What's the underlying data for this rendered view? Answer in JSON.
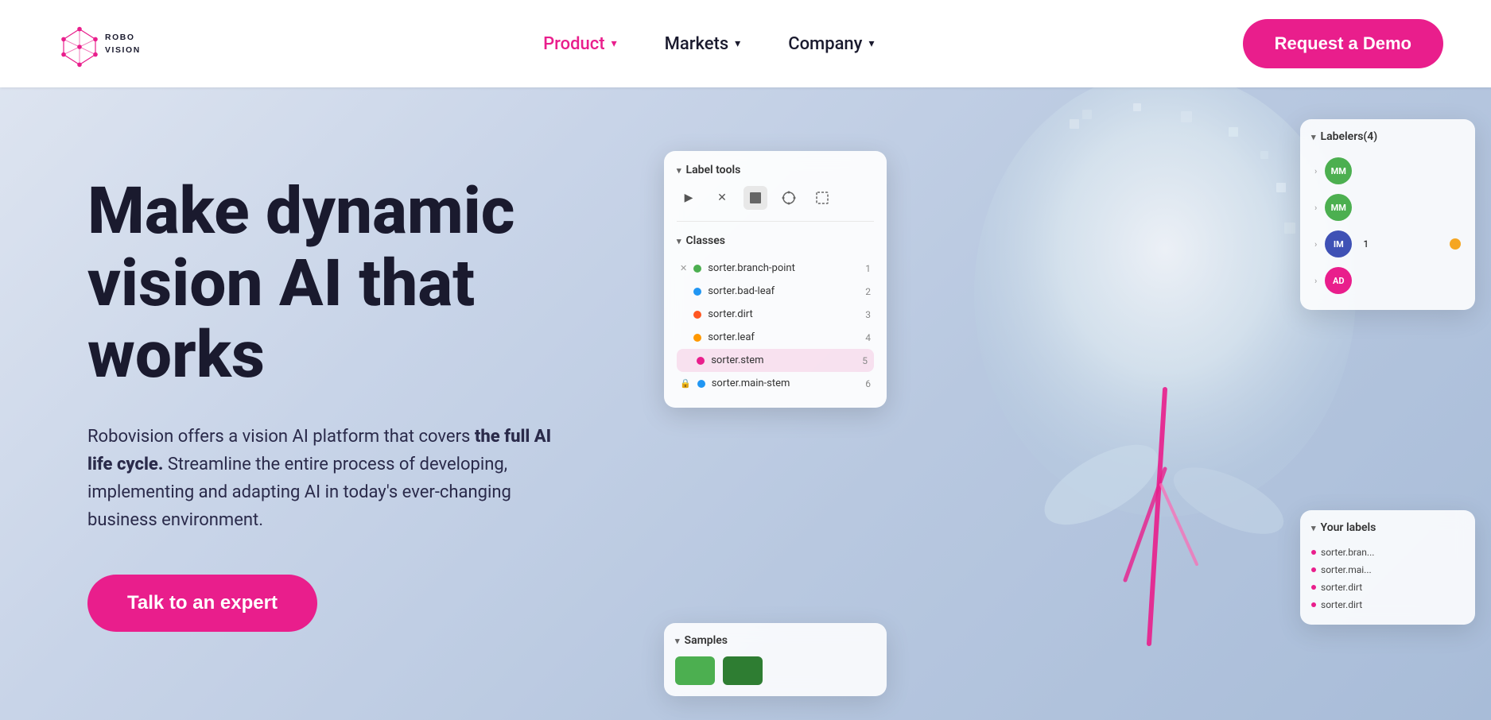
{
  "navbar": {
    "logo_text": "ROBOVISION",
    "nav_items": [
      {
        "label": "Product",
        "active": true,
        "has_dropdown": true
      },
      {
        "label": "Markets",
        "active": false,
        "has_dropdown": true
      },
      {
        "label": "Company",
        "active": false,
        "has_dropdown": true
      }
    ],
    "cta_label": "Request a Demo"
  },
  "hero": {
    "title_line1": "Make dynamic",
    "title_line2": "vision AI that",
    "title_line3": "works",
    "description_normal": "Robovision offers a vision AI platform that covers ",
    "description_bold": "the full AI life cycle.",
    "description_normal2": " Streamline the entire process of developing, implementing and adapting AI in today's ever-changing business environment.",
    "cta_label": "Talk to an expert"
  },
  "label_tools_panel": {
    "title": "Label tools",
    "tools": [
      "▶",
      "✕",
      "□",
      "○",
      "⬚"
    ],
    "classes_title": "Classes",
    "classes": [
      {
        "name": "sorter.branch-point",
        "color": "#4caf50",
        "number": "1",
        "prefix": "✕"
      },
      {
        "name": "sorter.bad-leaf",
        "color": "#2196f3",
        "number": "2",
        "prefix": ""
      },
      {
        "name": "sorter.dirt",
        "color": "#ff5722",
        "number": "3",
        "prefix": ""
      },
      {
        "name": "sorter.leaf",
        "color": "#ff9800",
        "number": "4",
        "prefix": ""
      },
      {
        "name": "sorter.stem",
        "color": "#e91e8c",
        "number": "5",
        "selected": true,
        "prefix": ""
      },
      {
        "name": "sorter.main-stem",
        "color": "#2196f3",
        "number": "6",
        "prefix": "🔒"
      }
    ]
  },
  "labelers_panel": {
    "title": "Labelers(4)",
    "labelers": [
      {
        "initials": "MM",
        "color": "#4caf50"
      },
      {
        "initials": "MM",
        "color": "#4caf50"
      },
      {
        "initials": "IM",
        "color": "#3f51b5",
        "badge": true
      },
      {
        "initials": "AD",
        "color": "#e91e8c"
      }
    ]
  },
  "your_labels_panel": {
    "title": "Your labels",
    "items": [
      "sorter.bran...",
      "sorter.mai...",
      "sorter.dirt",
      "sorter.dirt"
    ]
  },
  "samples_panel": {
    "title": "Samples"
  },
  "colors": {
    "primary_pink": "#e91e8c",
    "hero_bg_start": "#dde4f0",
    "hero_bg_end": "#a8bcd8",
    "heading_dark": "#1a1a2e",
    "nav_active": "#e91e8c"
  }
}
